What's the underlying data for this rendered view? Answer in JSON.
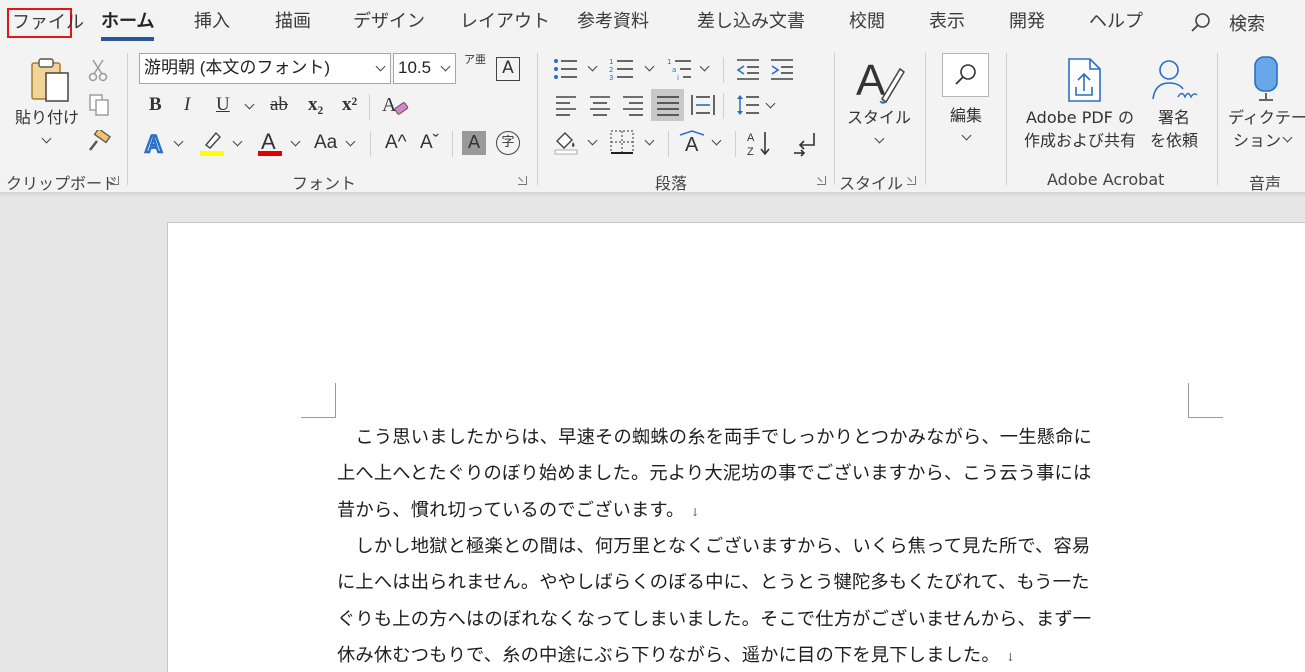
{
  "tabs": {
    "file": "ファイル",
    "home": "ホーム",
    "insert": "挿入",
    "draw": "描画",
    "design": "デザイン",
    "layout": "レイアウト",
    "references": "参考資料",
    "mailings": "差し込み文書",
    "review": "校閲",
    "view": "表示",
    "developer": "開発",
    "help": "ヘルプ",
    "search": "検索"
  },
  "clipboard": {
    "paste_label": "貼り付け",
    "group_label": "クリップボード"
  },
  "font": {
    "font_name": "游明朝 (本文のフォント)",
    "font_size": "10.5",
    "furigana": "ア亜",
    "enclosed": "A",
    "bold": "B",
    "italic": "I",
    "underline": "U",
    "strike": "ab",
    "subscript": "x₂",
    "superscript": "x²",
    "text_effect": "A",
    "font_color": "A",
    "change_case": "Aa",
    "grow": "A^",
    "shrink": "Aˇ",
    "char_shade": "A",
    "enclose_char": "字",
    "group_label": "フォント",
    "highlight_color": "#ffff00",
    "font_color_value": "#e00000"
  },
  "paragraph": {
    "group_label": "段落"
  },
  "styles": {
    "label": "スタイル",
    "group_label": "スタイル"
  },
  "editing": {
    "label": "編集"
  },
  "acrobat": {
    "pdf_label_1": "Adobe PDF の",
    "pdf_label_2": "作成および共有",
    "sign_label_1": "署名",
    "sign_label_2": "を依頼",
    "group_label": "Adobe Acrobat"
  },
  "voice": {
    "dictate_label_1": "ディクテー",
    "dictate_label_2": "ション",
    "group_label": "音声"
  },
  "document": {
    "paragraphs": [
      {
        "lines": [
          "　こう思いましたからは、早速その蜘蛛の糸を両手でしっかりとつかみながら、一生懸命に",
          "上へ上へとたぐりのぼり始めました。元より大泥坊の事でございますから、こう云う事には",
          "昔から、慣れ切っているのでございます。"
        ],
        "mark": "↓"
      },
      {
        "lines": [
          "　しかし地獄と極楽との間は、何万里となくございますから、いくら焦って見た所で、容易",
          "に上へは出られません。ややしばらくのぼる中に、とうとう犍陀多もくたびれて、もう一た",
          "ぐりも上の方へはのぼれなくなってしまいました。そこで仕方がございませんから、まず一",
          "休み休むつもりで、糸の中途にぶら下りながら、遥かに目の下を見下しました。"
        ],
        "mark": "↓"
      }
    ]
  }
}
